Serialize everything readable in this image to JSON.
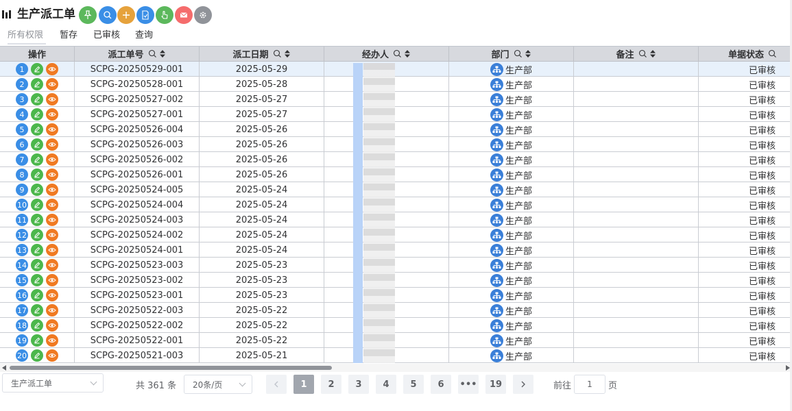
{
  "header": {
    "title": "生产派工单",
    "toolbar": [
      {
        "icon": "pin-icon",
        "color": "#5cb85c"
      },
      {
        "icon": "search-icon",
        "color": "#3a8ee6"
      },
      {
        "icon": "plus-icon",
        "color": "#e6a23c"
      },
      {
        "icon": "document-icon",
        "color": "#3a8ee6"
      },
      {
        "icon": "hand-pointer-icon",
        "color": "#5cb85c"
      },
      {
        "icon": "mail-icon",
        "color": "#f56c6c"
      },
      {
        "icon": "gear-icon",
        "color": "#909399"
      }
    ]
  },
  "tabs": [
    {
      "label": "所有权限",
      "active": true
    },
    {
      "label": "暂存",
      "active": false
    },
    {
      "label": "已审核",
      "active": false
    },
    {
      "label": "查询",
      "active": false
    }
  ],
  "table": {
    "columns": {
      "ops": "操作",
      "order_no": "派工单号",
      "date": "派工日期",
      "handler": "经办人",
      "dept": "部门",
      "remark": "备注",
      "status": "单据状态"
    },
    "rows": [
      {
        "idx": "1",
        "order_no": "SCPG-20250529-001",
        "date": "2025-05-29",
        "dept": "生产部",
        "status": "已审核"
      },
      {
        "idx": "2",
        "order_no": "SCPG-20250528-001",
        "date": "2025-05-28",
        "dept": "生产部",
        "status": "已审核"
      },
      {
        "idx": "3",
        "order_no": "SCPG-20250527-002",
        "date": "2025-05-27",
        "dept": "生产部",
        "status": "已审核"
      },
      {
        "idx": "4",
        "order_no": "SCPG-20250527-001",
        "date": "2025-05-27",
        "dept": "生产部",
        "status": "已审核"
      },
      {
        "idx": "5",
        "order_no": "SCPG-20250526-004",
        "date": "2025-05-26",
        "dept": "生产部",
        "status": "已审核"
      },
      {
        "idx": "6",
        "order_no": "SCPG-20250526-003",
        "date": "2025-05-26",
        "dept": "生产部",
        "status": "已审核"
      },
      {
        "idx": "7",
        "order_no": "SCPG-20250526-002",
        "date": "2025-05-26",
        "dept": "生产部",
        "status": "已审核"
      },
      {
        "idx": "8",
        "order_no": "SCPG-20250526-001",
        "date": "2025-05-26",
        "dept": "生产部",
        "status": "已审核"
      },
      {
        "idx": "9",
        "order_no": "SCPG-20250524-005",
        "date": "2025-05-24",
        "dept": "生产部",
        "status": "已审核"
      },
      {
        "idx": "10",
        "order_no": "SCPG-20250524-004",
        "date": "2025-05-24",
        "dept": "生产部",
        "status": "已审核"
      },
      {
        "idx": "11",
        "order_no": "SCPG-20250524-003",
        "date": "2025-05-24",
        "dept": "生产部",
        "status": "已审核"
      },
      {
        "idx": "12",
        "order_no": "SCPG-20250524-002",
        "date": "2025-05-24",
        "dept": "生产部",
        "status": "已审核"
      },
      {
        "idx": "13",
        "order_no": "SCPG-20250524-001",
        "date": "2025-05-24",
        "dept": "生产部",
        "status": "已审核"
      },
      {
        "idx": "14",
        "order_no": "SCPG-20250523-003",
        "date": "2025-05-23",
        "dept": "生产部",
        "status": "已审核"
      },
      {
        "idx": "15",
        "order_no": "SCPG-20250523-002",
        "date": "2025-05-23",
        "dept": "生产部",
        "status": "已审核"
      },
      {
        "idx": "16",
        "order_no": "SCPG-20250523-001",
        "date": "2025-05-23",
        "dept": "生产部",
        "status": "已审核"
      },
      {
        "idx": "17",
        "order_no": "SCPG-20250522-003",
        "date": "2025-05-22",
        "dept": "生产部",
        "status": "已审核"
      },
      {
        "idx": "18",
        "order_no": "SCPG-20250522-002",
        "date": "2025-05-22",
        "dept": "生产部",
        "status": "已审核"
      },
      {
        "idx": "19",
        "order_no": "SCPG-20250522-001",
        "date": "2025-05-22",
        "dept": "生产部",
        "status": "已审核"
      },
      {
        "idx": "20",
        "order_no": "SCPG-20250521-003",
        "date": "2025-05-21",
        "dept": "生产部",
        "status": "已审核"
      }
    ]
  },
  "footer": {
    "form_select": "生产派工单",
    "total": "共 361 条",
    "page_size": "20条/页",
    "pages": [
      "1",
      "2",
      "3",
      "4",
      "5",
      "6",
      "•••",
      "19"
    ],
    "current_page": "1",
    "goto_label": "前往",
    "goto_value": "1",
    "goto_suffix": "页"
  }
}
